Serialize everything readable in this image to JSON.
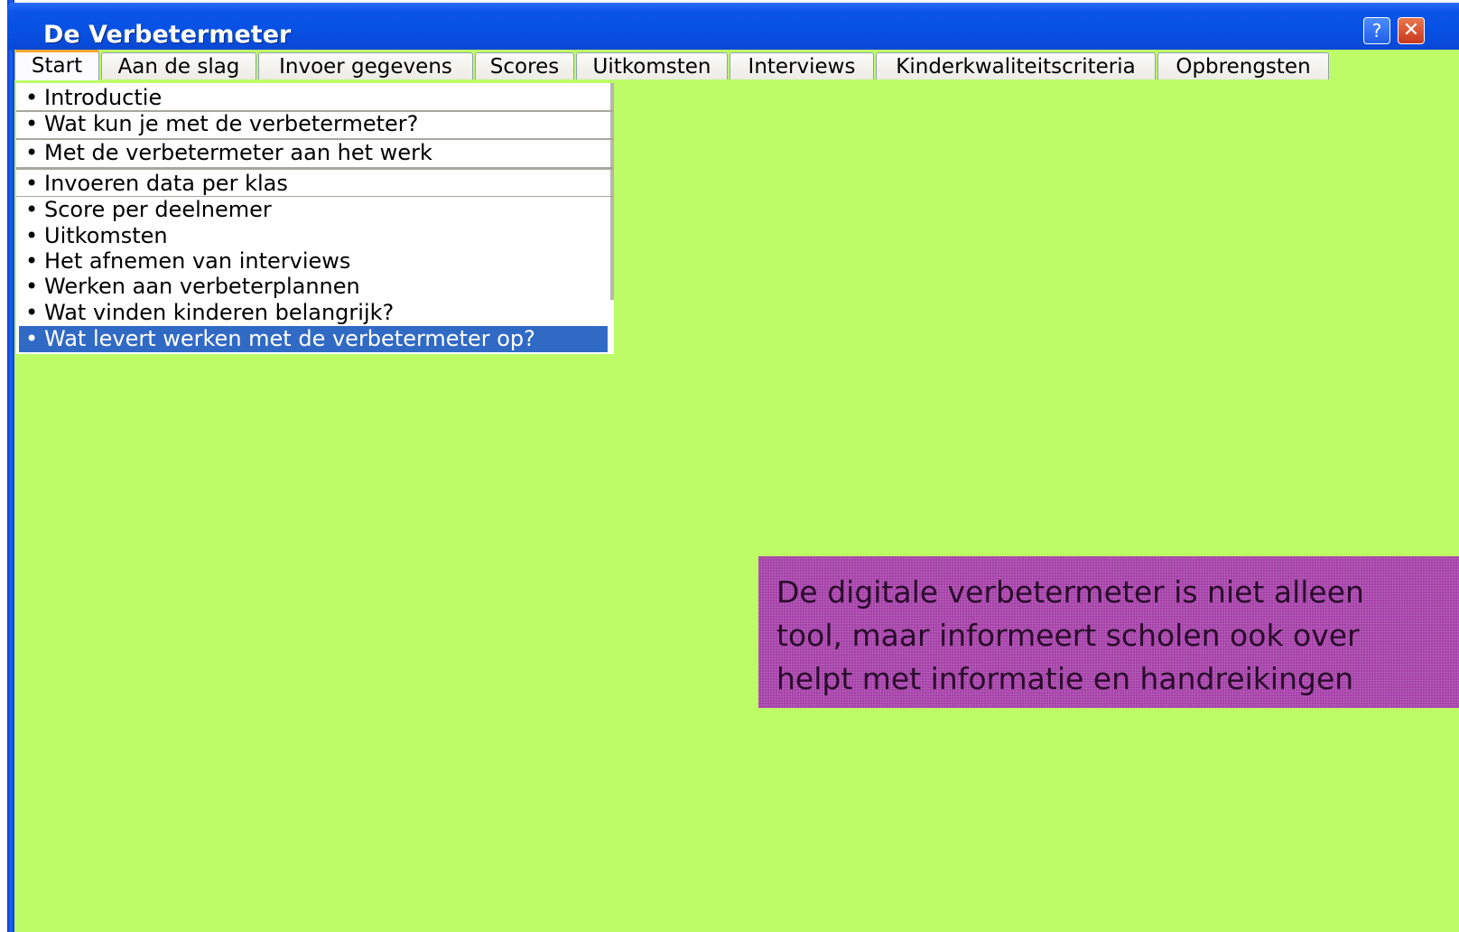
{
  "window": {
    "title": "De Verbetermeter",
    "help_label": "?",
    "close_label": "✕"
  },
  "tabs": [
    {
      "label": "Start",
      "active": true
    },
    {
      "label": "Aan de slag"
    },
    {
      "label": "Invoer gegevens"
    },
    {
      "label": "Scores"
    },
    {
      "label": "Uitkomsten"
    },
    {
      "label": "Interviews"
    },
    {
      "label": "Kinderkwaliteitscriteria"
    },
    {
      "label": "Opbrengsten"
    }
  ],
  "menu": {
    "bullet": "•",
    "items": [
      {
        "label": "Introductie"
      },
      {
        "label": "Wat kun je met de verbetermeter?"
      },
      {
        "label": "Met de verbetermeter aan het werk"
      },
      {
        "label": "Invoeren data per klas"
      },
      {
        "label": "Score per deelnemer"
      },
      {
        "label": "Uitkomsten"
      },
      {
        "label": "Het afnemen van interviews"
      },
      {
        "label": "Werken aan verbeterplannen"
      },
      {
        "label": "Wat vinden kinderen belangrijk?"
      },
      {
        "label": "Wat levert werken met de verbetermeter op?",
        "selected": true
      }
    ]
  },
  "message": {
    "text": "De digitale verbetermeter is niet alleen\ntool, maar informeert scholen ook over\nhelpt met informatie en handreikingen"
  },
  "colors": {
    "background": "#bdfc67",
    "titlebar": "#0650e4",
    "selection": "#316ac5",
    "message_bg": "#a540a8"
  }
}
